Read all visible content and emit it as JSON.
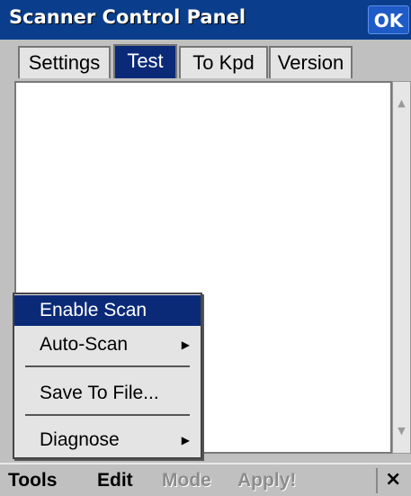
{
  "window": {
    "title": "Scanner Control Panel",
    "ok_label": "OK"
  },
  "tabs": [
    {
      "label": "Settings",
      "active": false
    },
    {
      "label": "Test",
      "active": true
    },
    {
      "label": "To Kpd",
      "active": false
    },
    {
      "label": "Version",
      "active": false
    }
  ],
  "menu": {
    "items": [
      {
        "label": "Enable Scan",
        "highlighted": true,
        "submenu": false
      },
      {
        "label": "Auto-Scan",
        "highlighted": false,
        "submenu": true
      },
      {
        "label": "Save To File...",
        "highlighted": false,
        "submenu": false
      },
      {
        "label": "Diagnose",
        "highlighted": false,
        "submenu": true
      }
    ]
  },
  "commandbar": {
    "tools": "Tools",
    "edit": "Edit",
    "mode": "Mode",
    "apply": "Apply!",
    "close": "×"
  },
  "icons": {
    "submenu_arrow": "▶",
    "scroll_up": "▲",
    "scroll_down": "▼"
  },
  "colors": {
    "titlebar": "#0a3e8c",
    "selection": "#0a2a78",
    "disabled_text": "#8c8c8c"
  }
}
